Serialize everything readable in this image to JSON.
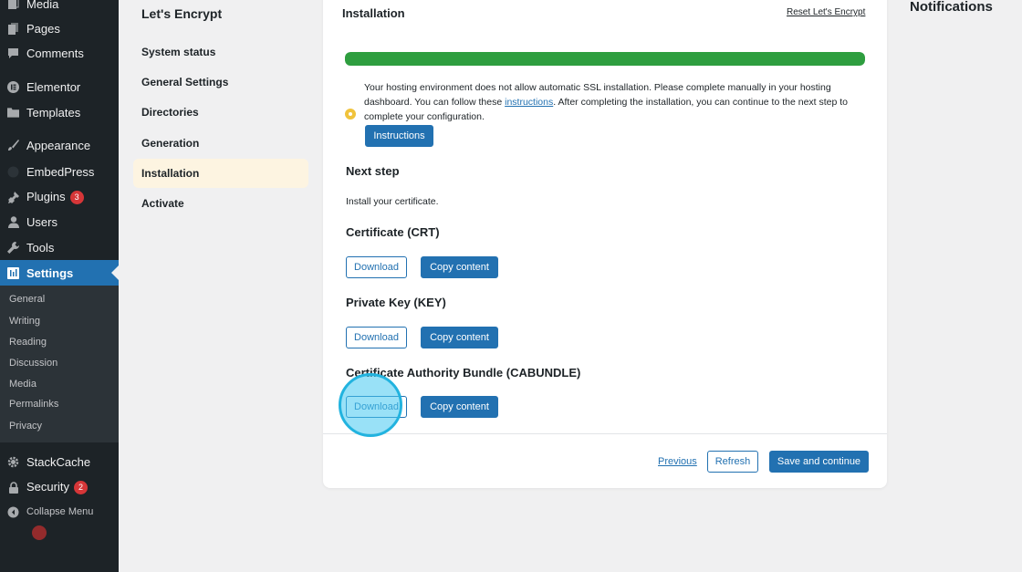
{
  "admin_menu": {
    "items": [
      {
        "label": "Media",
        "icon": "media-icon"
      },
      {
        "label": "Pages",
        "icon": "pages-icon"
      },
      {
        "label": "Comments",
        "icon": "comments-icon"
      },
      {
        "label": "Elementor",
        "icon": "elementor-icon"
      },
      {
        "label": "Templates",
        "icon": "folder-icon"
      },
      {
        "label": "Appearance",
        "icon": "paintbrush-icon"
      },
      {
        "label": "EmbedPress",
        "icon": "embedpress-icon"
      },
      {
        "label": "Plugins",
        "icon": "plugin-icon",
        "badge": "3"
      },
      {
        "label": "Users",
        "icon": "user-icon"
      },
      {
        "label": "Tools",
        "icon": "wrench-icon"
      },
      {
        "label": "Settings",
        "icon": "settings-icon"
      }
    ],
    "settings_submenu": [
      "General",
      "Writing",
      "Reading",
      "Discussion",
      "Media",
      "Permalinks",
      "Privacy"
    ],
    "bottom_items": [
      {
        "label": "StackCache",
        "icon": "gear-icon"
      },
      {
        "label": "Security",
        "icon": "lock-icon",
        "badge": "2"
      },
      {
        "label": "Collapse Menu",
        "icon": "collapse-icon"
      }
    ]
  },
  "settings_nav": {
    "title": "Let's Encrypt",
    "items": [
      "System status",
      "General Settings",
      "Directories",
      "Generation",
      "Installation",
      "Activate"
    ],
    "active": "Installation"
  },
  "panel": {
    "title": "Installation",
    "reset_link": "Reset Let's Encrypt",
    "progress_percent": 100,
    "progress_color": "#2e9e3f",
    "notice": {
      "text_before": "Your hosting environment does not allow automatic SSL installation. Please complete manually in your hosting dashboard. You can follow these ",
      "link": "instructions",
      "text_after": ". After completing the installation, you can continue to the next step to complete your configuration.",
      "button": "Instructions",
      "icon_color": "#f0c33c"
    },
    "next_step": {
      "heading": "Next step",
      "text": "Install your certificate."
    },
    "sections": [
      {
        "heading": "Certificate (CRT)",
        "download": "Download",
        "copy": "Copy content"
      },
      {
        "heading": "Private Key (KEY)",
        "download": "Download",
        "copy": "Copy content"
      },
      {
        "heading": "Certificate Authority Bundle (CABUNDLE)",
        "download": "Download",
        "copy": "Copy content"
      }
    ],
    "footer": {
      "previous": "Previous",
      "refresh": "Refresh",
      "save": "Save and continue"
    }
  },
  "notifications": {
    "title": "Notifications"
  },
  "colors": {
    "admin_bg": "#1d2327",
    "accent": "#2271b1",
    "active_nav_bg": "#fdf4e1",
    "badge": "#d63638"
  }
}
